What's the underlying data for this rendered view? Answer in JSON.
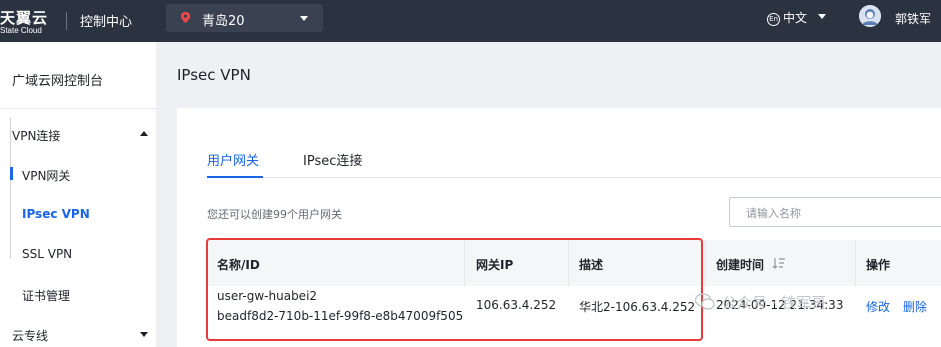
{
  "brand": {
    "name": "天翼云",
    "sub": "State Cloud"
  },
  "header": {
    "console_title": "控制中心",
    "region": "青岛20",
    "language_badge": "En",
    "language": "中文",
    "user_name": "郭铁军"
  },
  "sidebar": {
    "title": "广域云网控制台",
    "groups": [
      {
        "label": "VPN连接",
        "expanded": true,
        "items": [
          "VPN网关",
          "IPsec VPN",
          "SSL VPN",
          "证书管理"
        ],
        "active_item": "IPsec VPN"
      },
      {
        "label": "云专线",
        "expanded": false,
        "items": []
      }
    ]
  },
  "main": {
    "page_title": "IPsec VPN",
    "tabs": [
      {
        "label": "用户网关",
        "active": true
      },
      {
        "label": "IPsec连接",
        "active": false
      }
    ],
    "hint": "您还可以创建99个用户网关",
    "search_placeholder": "请输入名称",
    "table": {
      "columns": [
        "名称/ID",
        "网关IP",
        "描述",
        "创建时间",
        "操作"
      ],
      "rows": [
        {
          "name": "user-gw-huabei2",
          "id": "beadf8d2-710b-11ef-99f8-e8b47009f505",
          "ip": "106.63.4.252",
          "desc": "华北2-106.63.4.252",
          "created": "2024-09-12 21:34:33",
          "actions": [
            "修改",
            "删除"
          ]
        }
      ]
    }
  },
  "watermark": "公众号 · 铁军哥",
  "colors": {
    "topbar": "#2b3240",
    "accent": "#1964e8",
    "highlight": "#e83a3a"
  }
}
